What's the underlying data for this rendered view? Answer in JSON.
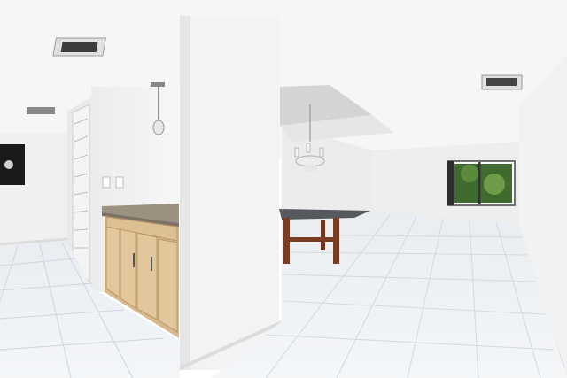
{
  "scene": {
    "kind": "photo",
    "palette": {
      "ceiling": "#f6f6f6",
      "wall_light": "#f1f1f1",
      "wall_shadow": "#e7e7e7",
      "floor": "#eef1f4",
      "floor_grout": "#cfd5dc",
      "cabinet_wood": "#d8b98d",
      "cabinet_dark": "#b99464",
      "granite": "#9c9080",
      "table_glass": "#3b3f44",
      "table_wood": "#7a3d23",
      "window_tree": "#3f6b2f",
      "artwork": "#1a1a1a",
      "vent": "#6b6b6b"
    },
    "objects": [
      "ceiling-vent-icon",
      "pendant-light-icon",
      "chandelier-icon",
      "louvered-closet-door",
      "kitchen-cabinet",
      "granite-countertop",
      "glass-dining-table",
      "window",
      "wall-art",
      "tile-floor"
    ]
  }
}
